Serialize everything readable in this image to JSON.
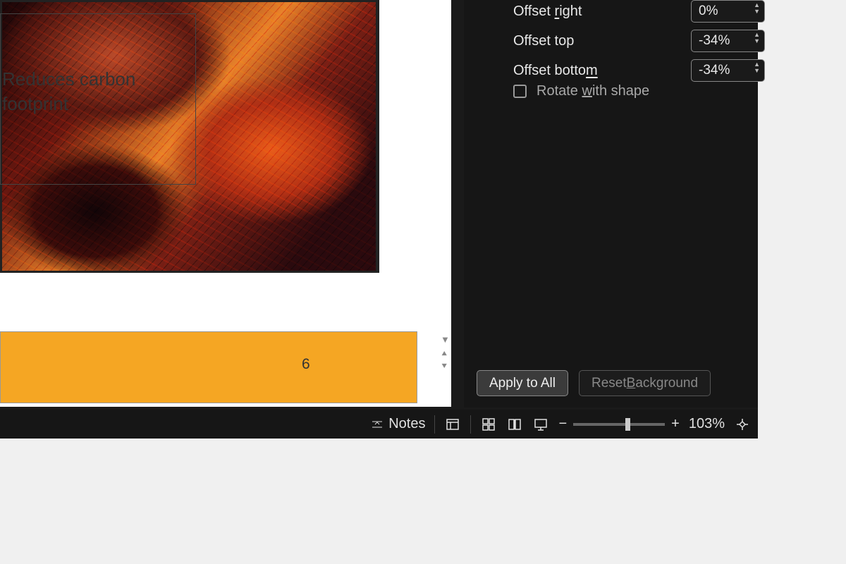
{
  "slide": {
    "text_line1": "Reduces carbon",
    "text_line2": "footprint",
    "number": "6"
  },
  "panel": {
    "offset_right": {
      "label_pre": "Offset ",
      "label_u": "r",
      "label_post": "ight",
      "value": "0%"
    },
    "offset_top": {
      "label": "Offset top",
      "value": "-34%"
    },
    "offset_bottom": {
      "label_pre": "Offset botto",
      "label_u": "m",
      "label_post": "",
      "value": "-34%"
    },
    "rotate": {
      "label_pre": "Rotate ",
      "label_u": "w",
      "label_post": "ith shape"
    },
    "apply_all": "Apply to All",
    "reset_pre": "Reset ",
    "reset_u": "B",
    "reset_post": "ackground"
  },
  "status": {
    "notes": "Notes",
    "zoom_pct": "103%"
  }
}
